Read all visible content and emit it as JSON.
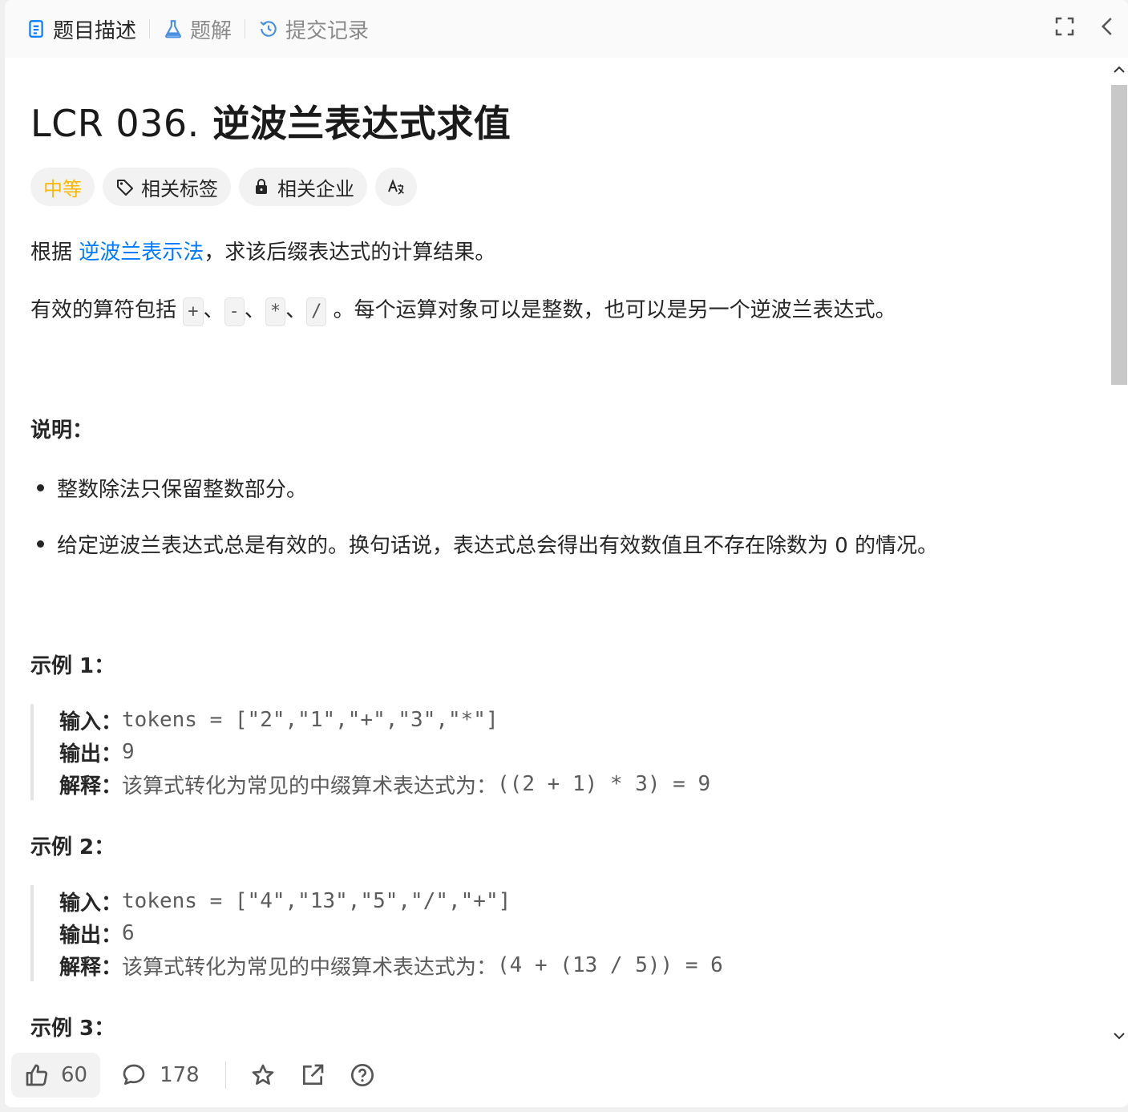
{
  "tabs": [
    {
      "label": "题目描述",
      "icon": "document-icon"
    },
    {
      "label": "题解",
      "icon": "flask-icon"
    },
    {
      "label": "提交记录",
      "icon": "history-icon"
    }
  ],
  "problem": {
    "title_num": "LCR 036.",
    "title_text": "逆波兰表达式求值",
    "difficulty": "中等",
    "tag_topics": "相关标签",
    "tag_companies": "相关企业"
  },
  "description": {
    "p1_prefix": "根据",
    "p1_link": "逆波兰表示法",
    "p1_suffix": "，求该后缀表达式的计算结果。",
    "p2_prefix": "有效的算符包括",
    "op_plus": "+",
    "op_minus": "-",
    "op_mul": "*",
    "op_div": "/",
    "sep": "、",
    "p2_suffix": "。每个运算对象可以是整数，也可以是另一个逆波兰表达式。"
  },
  "notes": {
    "heading": "说明：",
    "items": [
      "整数除法只保留整数部分。",
      "给定逆波兰表达式总是有效的。换句话说，表达式总会得出有效数值且不存在除数为 0 的情况。"
    ]
  },
  "examples": [
    {
      "heading": "示例 1：",
      "input_label": "输入：",
      "input": "tokens = [\"2\",\"1\",\"+\",\"3\",\"*\"]",
      "output_label": "输出：",
      "output": "9",
      "explain_label": "解释：",
      "explain_text": "该算式转化为常见的中缀算术表达式为：",
      "explain_code": "((2 + 1) * 3) = 9"
    },
    {
      "heading": "示例 2：",
      "input_label": "输入：",
      "input": "tokens = [\"4\",\"13\",\"5\",\"/\",\"+\"]",
      "output_label": "输出：",
      "output": "6",
      "explain_label": "解释：",
      "explain_text": "该算式转化为常见的中缀算术表达式为：",
      "explain_code": "(4 + (13 / 5)) = 6"
    },
    {
      "heading": "示例 3："
    }
  ],
  "footer": {
    "likes": "60",
    "comments": "178"
  },
  "colors": {
    "difficulty_medium": "#ffb800",
    "link": "#007aff"
  }
}
